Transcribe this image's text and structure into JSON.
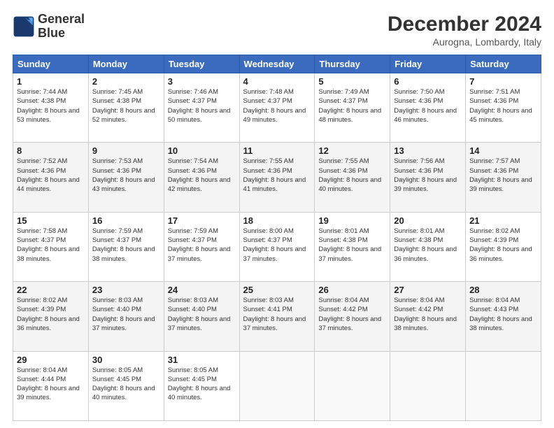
{
  "header": {
    "logo_line1": "General",
    "logo_line2": "Blue",
    "main_title": "December 2024",
    "subtitle": "Aurogna, Lombardy, Italy"
  },
  "days_of_week": [
    "Sunday",
    "Monday",
    "Tuesday",
    "Wednesday",
    "Thursday",
    "Friday",
    "Saturday"
  ],
  "weeks": [
    [
      {
        "day": "1",
        "sunrise": "7:44 AM",
        "sunset": "4:38 PM",
        "daylight": "8 hours and 53 minutes."
      },
      {
        "day": "2",
        "sunrise": "7:45 AM",
        "sunset": "4:38 PM",
        "daylight": "8 hours and 52 minutes."
      },
      {
        "day": "3",
        "sunrise": "7:46 AM",
        "sunset": "4:37 PM",
        "daylight": "8 hours and 50 minutes."
      },
      {
        "day": "4",
        "sunrise": "7:48 AM",
        "sunset": "4:37 PM",
        "daylight": "8 hours and 49 minutes."
      },
      {
        "day": "5",
        "sunrise": "7:49 AM",
        "sunset": "4:37 PM",
        "daylight": "8 hours and 48 minutes."
      },
      {
        "day": "6",
        "sunrise": "7:50 AM",
        "sunset": "4:36 PM",
        "daylight": "8 hours and 46 minutes."
      },
      {
        "day": "7",
        "sunrise": "7:51 AM",
        "sunset": "4:36 PM",
        "daylight": "8 hours and 45 minutes."
      }
    ],
    [
      {
        "day": "8",
        "sunrise": "7:52 AM",
        "sunset": "4:36 PM",
        "daylight": "8 hours and 44 minutes."
      },
      {
        "day": "9",
        "sunrise": "7:53 AM",
        "sunset": "4:36 PM",
        "daylight": "8 hours and 43 minutes."
      },
      {
        "day": "10",
        "sunrise": "7:54 AM",
        "sunset": "4:36 PM",
        "daylight": "8 hours and 42 minutes."
      },
      {
        "day": "11",
        "sunrise": "7:55 AM",
        "sunset": "4:36 PM",
        "daylight": "8 hours and 41 minutes."
      },
      {
        "day": "12",
        "sunrise": "7:55 AM",
        "sunset": "4:36 PM",
        "daylight": "8 hours and 40 minutes."
      },
      {
        "day": "13",
        "sunrise": "7:56 AM",
        "sunset": "4:36 PM",
        "daylight": "8 hours and 39 minutes."
      },
      {
        "day": "14",
        "sunrise": "7:57 AM",
        "sunset": "4:36 PM",
        "daylight": "8 hours and 39 minutes."
      }
    ],
    [
      {
        "day": "15",
        "sunrise": "7:58 AM",
        "sunset": "4:37 PM",
        "daylight": "8 hours and 38 minutes."
      },
      {
        "day": "16",
        "sunrise": "7:59 AM",
        "sunset": "4:37 PM",
        "daylight": "8 hours and 38 minutes."
      },
      {
        "day": "17",
        "sunrise": "7:59 AM",
        "sunset": "4:37 PM",
        "daylight": "8 hours and 37 minutes."
      },
      {
        "day": "18",
        "sunrise": "8:00 AM",
        "sunset": "4:37 PM",
        "daylight": "8 hours and 37 minutes."
      },
      {
        "day": "19",
        "sunrise": "8:01 AM",
        "sunset": "4:38 PM",
        "daylight": "8 hours and 37 minutes."
      },
      {
        "day": "20",
        "sunrise": "8:01 AM",
        "sunset": "4:38 PM",
        "daylight": "8 hours and 36 minutes."
      },
      {
        "day": "21",
        "sunrise": "8:02 AM",
        "sunset": "4:39 PM",
        "daylight": "8 hours and 36 minutes."
      }
    ],
    [
      {
        "day": "22",
        "sunrise": "8:02 AM",
        "sunset": "4:39 PM",
        "daylight": "8 hours and 36 minutes."
      },
      {
        "day": "23",
        "sunrise": "8:03 AM",
        "sunset": "4:40 PM",
        "daylight": "8 hours and 37 minutes."
      },
      {
        "day": "24",
        "sunrise": "8:03 AM",
        "sunset": "4:40 PM",
        "daylight": "8 hours and 37 minutes."
      },
      {
        "day": "25",
        "sunrise": "8:03 AM",
        "sunset": "4:41 PM",
        "daylight": "8 hours and 37 minutes."
      },
      {
        "day": "26",
        "sunrise": "8:04 AM",
        "sunset": "4:42 PM",
        "daylight": "8 hours and 37 minutes."
      },
      {
        "day": "27",
        "sunrise": "8:04 AM",
        "sunset": "4:42 PM",
        "daylight": "8 hours and 38 minutes."
      },
      {
        "day": "28",
        "sunrise": "8:04 AM",
        "sunset": "4:43 PM",
        "daylight": "8 hours and 38 minutes."
      }
    ],
    [
      {
        "day": "29",
        "sunrise": "8:04 AM",
        "sunset": "4:44 PM",
        "daylight": "8 hours and 39 minutes."
      },
      {
        "day": "30",
        "sunrise": "8:05 AM",
        "sunset": "4:45 PM",
        "daylight": "8 hours and 40 minutes."
      },
      {
        "day": "31",
        "sunrise": "8:05 AM",
        "sunset": "4:45 PM",
        "daylight": "8 hours and 40 minutes."
      },
      null,
      null,
      null,
      null
    ]
  ]
}
